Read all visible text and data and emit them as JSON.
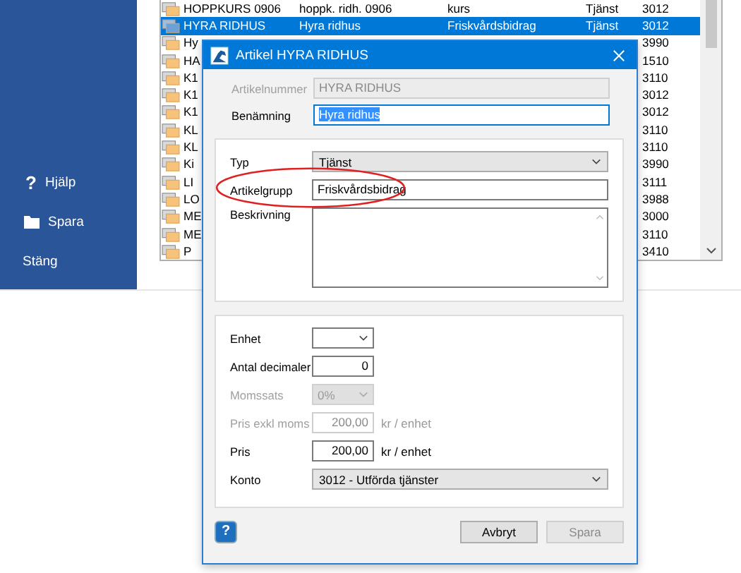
{
  "sidebar": {
    "items": [
      {
        "kind": "help",
        "glyph": "?",
        "label": "Hjälp"
      },
      {
        "kind": "folder",
        "label": "Spara"
      },
      {
        "kind": "plain",
        "label": "Stäng"
      }
    ]
  },
  "list": {
    "rows": [
      {
        "name": "HOPPKURS 0906",
        "description": "hoppk. ridh. 0906",
        "group": "kurs",
        "type": "Tjänst",
        "account": "3012",
        "selected": false
      },
      {
        "name": "HYRA RIDHUS",
        "description": "Hyra ridhus",
        "group": "Friskvårdsbidrag",
        "type": "Tjänst",
        "account": "3012",
        "selected": true
      },
      {
        "name": "Hy",
        "account": "3990",
        "selected": false
      },
      {
        "name": "HA",
        "account": "1510",
        "selected": false
      },
      {
        "name": "K1",
        "account": "3110",
        "selected": false
      },
      {
        "name": "K1",
        "account": "3012",
        "selected": false
      },
      {
        "name": "K1",
        "account": "3012",
        "selected": false
      },
      {
        "name": "KL",
        "account": "3110",
        "selected": false
      },
      {
        "name": "KL",
        "account": "3110",
        "selected": false
      },
      {
        "name": "Ki",
        "account": "3990",
        "selected": false
      },
      {
        "name": "LI",
        "account": "3111",
        "selected": false
      },
      {
        "name": "LO",
        "account": "3988",
        "selected": false
      },
      {
        "name": "ME",
        "account": "3000",
        "selected": false
      },
      {
        "name": "ME",
        "account": "3110",
        "selected": false
      },
      {
        "name": "P",
        "account": "3410",
        "selected": false
      }
    ]
  },
  "dialog": {
    "title": "Artikel HYRA RIDHUS",
    "fields": [
      {
        "kind": "input",
        "label": "Artikelnummer",
        "value": "HYRA RIDHUS",
        "disabled": true,
        "focused": false
      },
      {
        "kind": "input",
        "label": "Benämning",
        "value": "Hyra ridhus",
        "disabled": false,
        "focused": true
      }
    ],
    "group1": [
      {
        "kind": "select",
        "label": "Typ",
        "value": "Tjänst",
        "disabled": false
      },
      {
        "kind": "input",
        "label": "Artikelgrupp",
        "value": "Friskvårdsbidrag",
        "disabled": false
      },
      {
        "kind": "textarea",
        "label": "Beskrivning",
        "disabled": false
      }
    ],
    "group2": [
      {
        "kind": "short-select",
        "label": "Enhet",
        "disabled": false
      },
      {
        "kind": "number",
        "label": "Antal decimaler",
        "value": "0",
        "disabled": false
      },
      {
        "kind": "short-select",
        "label": "Momssats",
        "value": "0%",
        "disabled": true
      },
      {
        "kind": "number",
        "label": "Pris exkl moms",
        "value": "200,00",
        "unit": "kr / enhet",
        "disabled": true
      },
      {
        "kind": "number",
        "label": "Pris",
        "value": "200,00",
        "unit": "kr / enhet",
        "disabled": false
      },
      {
        "kind": "select",
        "label": "Konto",
        "value": "3012 - Utförda tjänster",
        "disabled": false
      }
    ],
    "help_button": {
      "glyph": "?"
    },
    "buttons": [
      {
        "label": "Avbryt",
        "disabled": false
      },
      {
        "label": "Spara",
        "disabled": true
      }
    ]
  }
}
